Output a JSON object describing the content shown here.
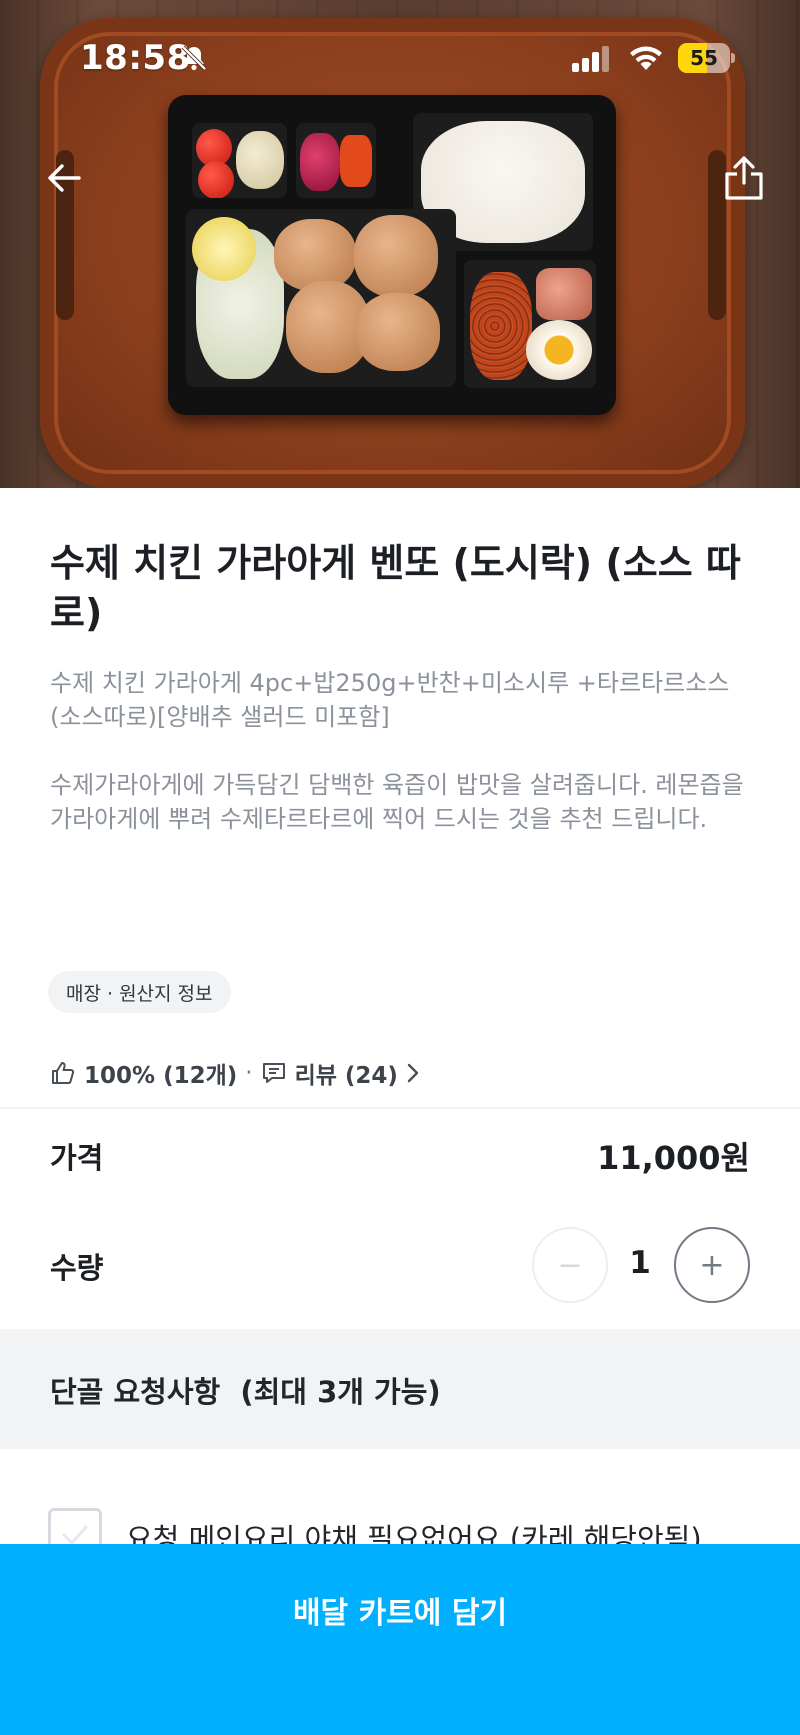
{
  "status_bar": {
    "time": "18:58",
    "battery_level": "55",
    "battery_percent": 55,
    "battery_color": "#ffd60a"
  },
  "nav": {
    "back_icon": "arrow-left-icon",
    "share_icon": "share-icon"
  },
  "product": {
    "title": "수제 치킨 가라아게 벤또 (도시락) (소스 따로)",
    "description": "수제 치킨 가라아게 4pc+밥250g+반찬+미소시루 +타르타르소스(소스따로)[양배추 샐러드 미포함]\n\n수제가라아게에 가득담긴 담백한 육즙이 밥맛을 살려줍니다. 레몬즙을 가라아게에 뿌려 수제타르타르에 찍어 드시는 것을 추천 드립니다.",
    "origin_chip": "매장 · 원산지 정보",
    "rating": "100% (12개)",
    "separator": "·",
    "reviews": "리뷰 (24)"
  },
  "price": {
    "label": "가격",
    "value": "11,000원"
  },
  "quantity": {
    "label": "수량",
    "value": "1",
    "minus": "−",
    "plus": "+"
  },
  "requests": {
    "header": "단골 요청사항  (최대 3개 가능)",
    "options": [
      {
        "label": "요청.메인요리 야채 필요없어요 (카레 해당안됨)",
        "checked": false
      }
    ]
  },
  "cta": {
    "label": "배달 카트에 담기",
    "color": "#00b0ff"
  }
}
